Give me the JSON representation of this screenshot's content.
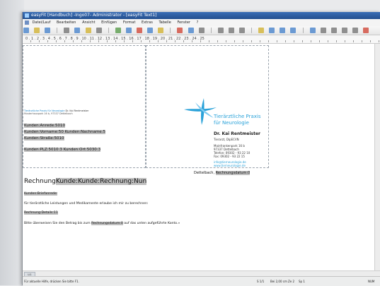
{
  "window": {
    "title": "easyFit [Handbuch] -Ingo07- Administrator - [easyFit Text1]"
  },
  "menu": [
    "Datei/Lauf",
    "Bearbeiten",
    "Ansicht",
    "Einfügen",
    "Format",
    "Extras",
    "Tabelle",
    "Fenster",
    "?"
  ],
  "ruler": {
    "scale": "0 . 1 . 2 . 3 . 4 . 5 . 6 . 7 . 8 . 9 . 10 . 11 . 12 . 13 . 14 . 15 . 16 . 17 . 18 . 19 . 20 . 21 . 22 . 23 . 24 . 25"
  },
  "letterhead": {
    "sender_practice": "Tierärztliche Praxis für Neurologie",
    "sender_person": "Dr. Kai Rentmeister",
    "sender_address": "Musterhauspark 16 b, 97337 Dettelbach",
    "logo_line1": "Tierärztliche Praxis",
    "logo_line2": "für Neurologie",
    "name": "Dr. Kai Rentmeister",
    "title": "Tierarzt, DipECVN",
    "street": "Mainfrankenpark 16 b",
    "city": "97337 Dettelbach",
    "phone": "Telefon: 09302 - 93 22 10",
    "fax": "Fax: 09302 - 93 22 15",
    "email": "info@tierneurologie.de",
    "web": "www.tierneurologie.de"
  },
  "address_fields": {
    "anrede": "Kunden:Anrede:5010",
    "name": "Kunden:Vorname:50 Kunden:Nachname:5",
    "strasse": "Kunden:Straße:5010",
    "plz_ort": "Kunden:PLZ:5010:3 Kunden:Ort:5030:3"
  },
  "letter": {
    "place": "Dettelbach,",
    "date_field": "Rechnungsdatum:0",
    "heading_prefix": "Rechnung",
    "heading_field": "Kunde:Kunde:Rechnung:Nun",
    "salutation": "Kunden:Briefanrede:",
    "intro": "für tierärztliche Leistungen und Medikamente erlaube ich mir zu berechnen:",
    "details": "Rechnung:Details:11",
    "closing_pre": "Bitte überweisen Sie den Betrag bis zum",
    "closing_field": "Rechnungsdatum:0",
    "closing_post": "auf das unten aufgeführte Konto.»"
  },
  "page_indicator": "Li1",
  "status": {
    "help": "Für aktuelle Hilfe, drücken Sie bitte F1.",
    "page": "S 1/1",
    "position": "Bei 2,00 cm",
    "line": "Ze 2",
    "column": "Sp 1",
    "mode": "NUM"
  },
  "colors": {
    "titlebar": "#2d5fa3",
    "accent": "#2aa2d9"
  }
}
